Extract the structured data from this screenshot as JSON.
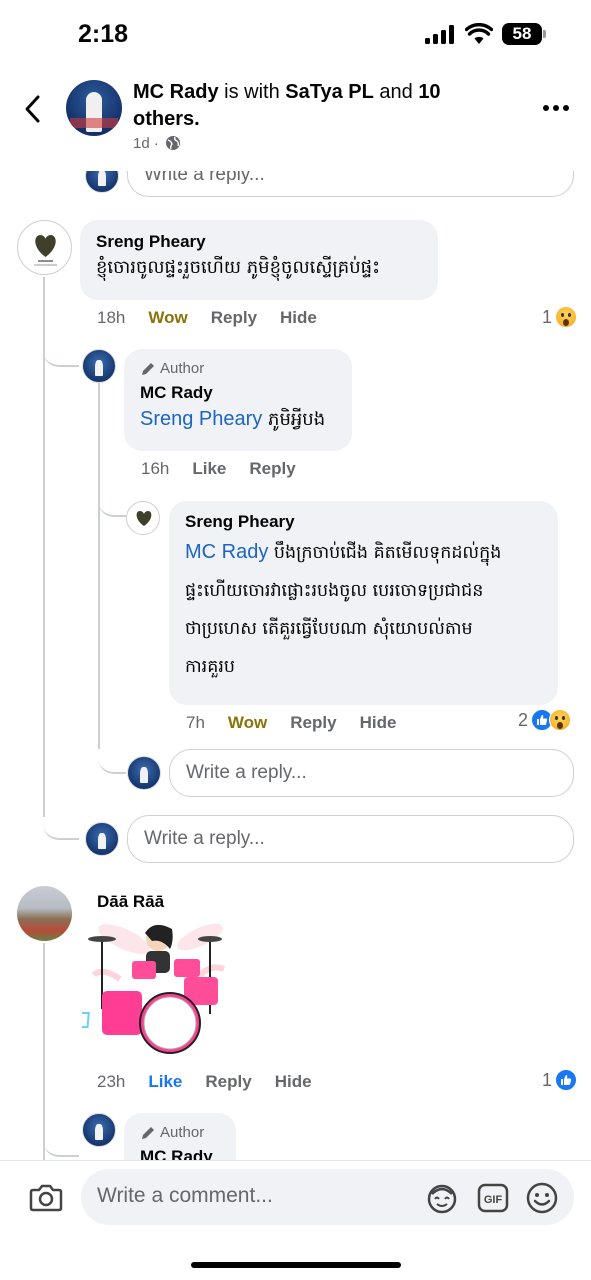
{
  "status_bar": {
    "time": "2:18",
    "battery": "58"
  },
  "header": {
    "poster": "MC Rady",
    "is_with": " is with ",
    "tagged": "SaTya PL",
    "and": " and ",
    "others": "10 others.",
    "meta": "1d ·"
  },
  "reply_placeholder": "Write a reply...",
  "comments": [
    {
      "name": "Sreng Pheary",
      "text": "ខ្ញុំចោរចូលផ្ទះរួចហើយ ភូមិខ្ញុំចូលស្ទើគ្រប់ផ្ទះ",
      "time": "18h",
      "actions": [
        "Wow",
        "Reply",
        "Hide"
      ],
      "reaction_count": "1",
      "replies": [
        {
          "author_badge": "Author",
          "name": "MC Rady",
          "mention": "Sreng Pheary",
          "text": " ភូមិអ្វីបង",
          "time": "16h",
          "actions": [
            "Like",
            "Reply"
          ]
        },
        {
          "name": "Sreng Pheary",
          "mention": "MC Rady",
          "lines": [
            " បឹងក្រចាប់ជើង គិតមើលទុកដល់ក្នុង",
            "ផ្ទះហើយចោរវាផ្លោះរបងចូល បេរចោទប្រជាជន",
            "ថាប្រហេស តើគួរធ្វើបែបណា សុំយោបល់តាម",
            "ការគួរប"
          ],
          "time": "7h",
          "actions": [
            "Wow",
            "Reply",
            "Hide"
          ],
          "reaction_count": "2"
        }
      ]
    },
    {
      "name": "Dāā Rāā",
      "time": "23h",
      "actions": [
        "Like",
        "Reply",
        "Hide"
      ],
      "reaction_count": "1",
      "replies": [
        {
          "author_badge": "Author",
          "name": "MC Rady"
        }
      ]
    }
  ],
  "bottom": {
    "comment_placeholder": "Write a comment..."
  },
  "colors": {
    "mention": "#1b65c3",
    "like": "#1877f2",
    "wow": "#8a7308",
    "bubble": "#f0f2f5",
    "secondary_text": "#65676b"
  },
  "icons": [
    "back-arrow-icon",
    "more-icon",
    "globe-icon",
    "pencil-icon",
    "camera-icon",
    "avatar-sticker-icon",
    "gif-icon",
    "emoji-icon",
    "wow-reaction-icon",
    "like-reaction-icon"
  ]
}
